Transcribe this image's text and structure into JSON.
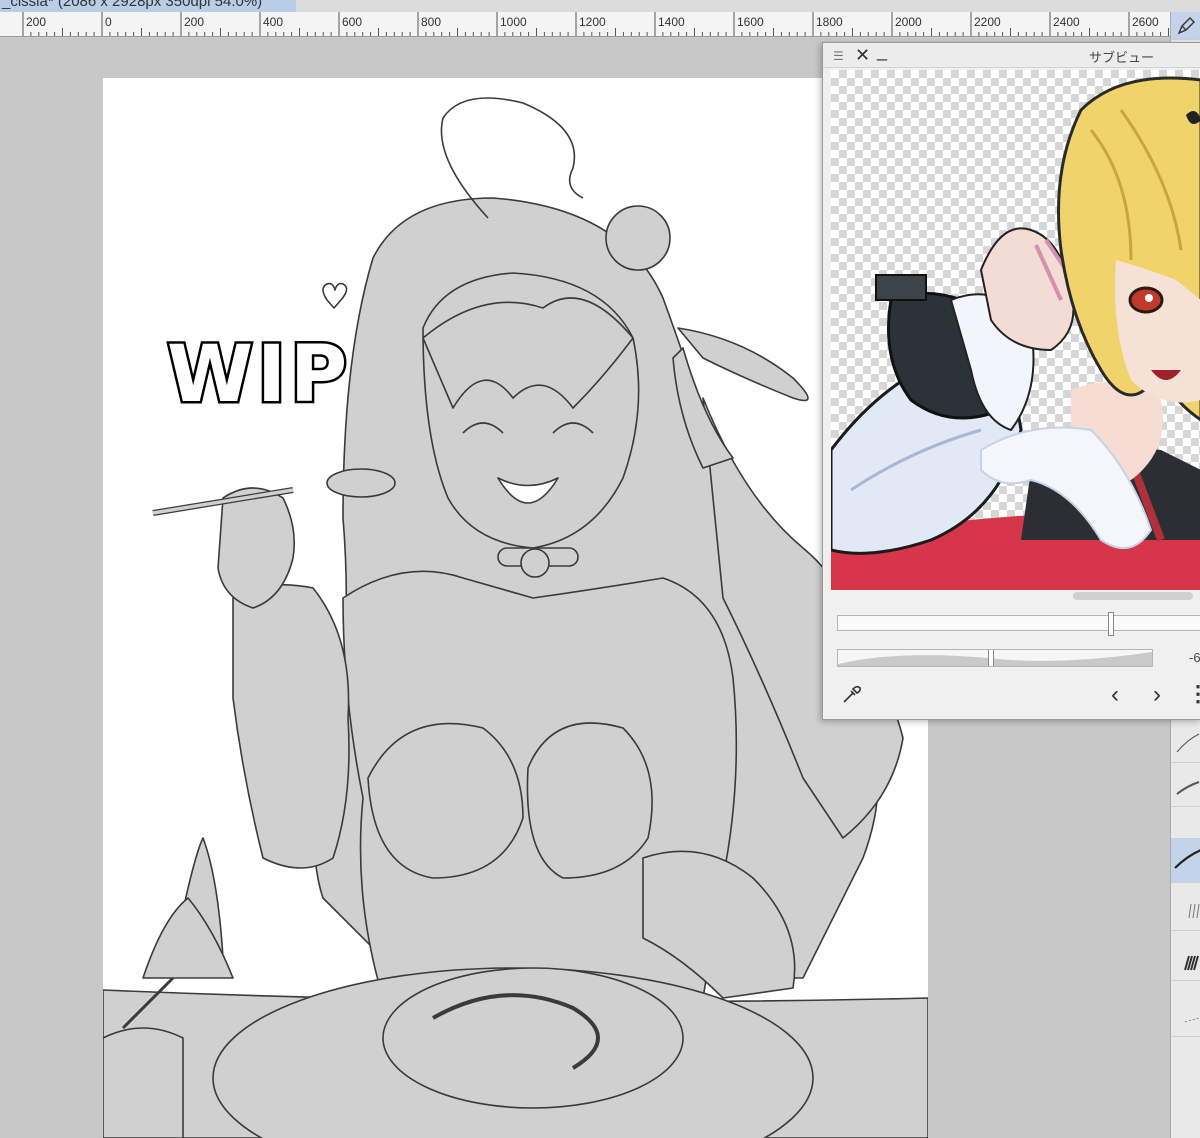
{
  "window": {
    "document_title": "_cissia* (2086 x 2928px 350dpi 54.0%)"
  },
  "ruler": {
    "labels": [
      "200",
      "0",
      "200",
      "400",
      "600",
      "800",
      "1000",
      "1200",
      "1400",
      "1600",
      "1800",
      "2000",
      "2200",
      "2400",
      "2600"
    ]
  },
  "canvas": {
    "wip_text": "WIP"
  },
  "subview": {
    "title": "サブビュー",
    "value_readout": "-6",
    "prev_symbol": "‹",
    "next_symbol": "›"
  },
  "colors": {
    "workspace": "#c8c8c8",
    "panel_accent": "#c3d4ea",
    "lineart_fill": "#d0d0d0",
    "hair_blonde": "#f1d36b",
    "ref_red": "#d63a4b",
    "ref_blue": "#dfe7f6"
  },
  "icons": [
    "menu-icon",
    "close-icon",
    "minimize-icon",
    "eyedropper-icon",
    "pen-tool-icon",
    "chevron-left-icon",
    "chevron-right-icon",
    "more-icon"
  ]
}
